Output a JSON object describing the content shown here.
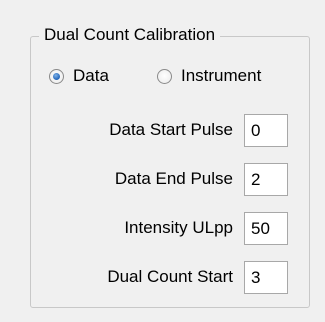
{
  "group": {
    "title": "Dual Count Calibration"
  },
  "mode": {
    "options": [
      {
        "label": "Data",
        "checked": true
      },
      {
        "label": "Instrument",
        "checked": false
      }
    ],
    "selected": "Data"
  },
  "fields": [
    {
      "label": "Data Start Pulse",
      "value": "0"
    },
    {
      "label": "Data End Pulse",
      "value": "2"
    },
    {
      "label": "Intensity ULpp",
      "value": "50"
    },
    {
      "label": "Dual Count Start",
      "value": "3"
    }
  ],
  "colors": {
    "background": "#f0f0f0",
    "border": "#c8c8c8",
    "radio_selected": "#1f63b8"
  }
}
